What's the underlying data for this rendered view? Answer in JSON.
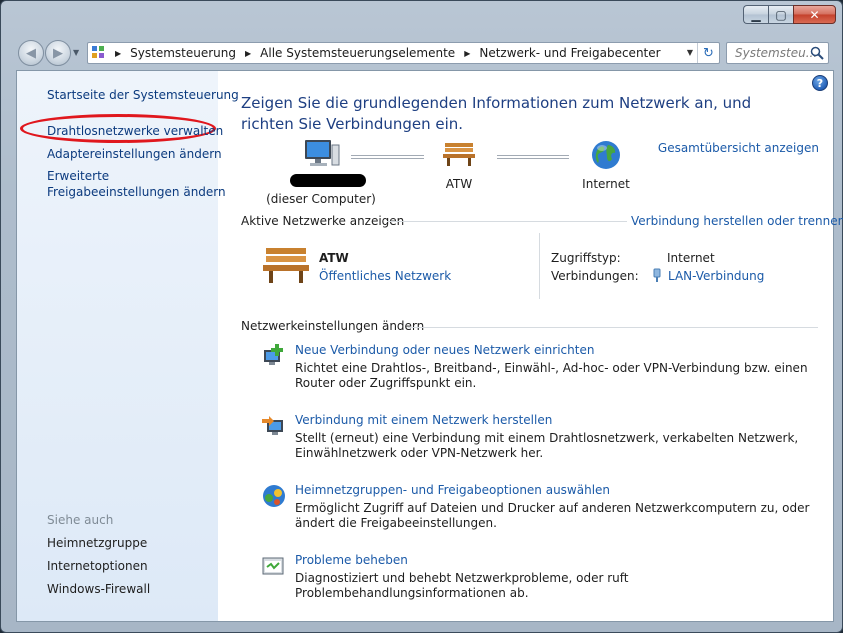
{
  "window": {
    "caption": {
      "minimize": "▁",
      "maximize": "▢",
      "close": "✕"
    }
  },
  "nav": {
    "back_glyph": "◀",
    "forward_glyph": "▶",
    "breadcrumbs": [
      "Systemsteuerung",
      "Alle Systemsteuerungselemente",
      "Netzwerk- und Freigabecenter"
    ],
    "refresh_glyph": "↻",
    "search_placeholder": "Systemsteu..."
  },
  "sidebar": {
    "links": [
      "Startseite der Systemsteuerung",
      "Drahtlosnetzwerke verwalten",
      "Adaptereinstellungen ändern"
    ],
    "link_multiline_1": "Erweiterte",
    "link_multiline_2": "Freigabeeinstellungen ändern",
    "see_also_heading": "Siehe auch",
    "see_also": [
      "Heimnetzgruppe",
      "Internetoptionen",
      "Windows-Firewall"
    ],
    "highlight_color": "#e0171d"
  },
  "main": {
    "help_label": "?",
    "title": "Zeigen Sie die grundlegenden Informationen zum Netzwerk an, und richten Sie Verbindungen ein.",
    "overview_link": "Gesamtübersicht anzeigen",
    "map": {
      "computer_label": "(dieser Computer)",
      "network_label": "ATW",
      "internet_label": "Internet"
    },
    "active_networks": {
      "heading": "Aktive Netzwerke anzeigen",
      "connect_link": "Verbindung herstellen oder trennen",
      "network_name": "ATW",
      "network_type": "Öffentliches Netzwerk",
      "access_label": "Zugriffstyp:",
      "access_value": "Internet",
      "connections_label": "Verbindungen:",
      "connections_value": "LAN-Verbindung"
    },
    "settings": {
      "heading": "Netzwerkeinstellungen ändern",
      "tasks": [
        {
          "link": "Neue Verbindung oder neues Netzwerk einrichten",
          "desc": "Richtet eine Drahtlos-, Breitband-, Einwähl-, Ad-hoc- oder VPN-Verbindung bzw. einen Router oder Zugriffspunkt ein.",
          "icon": "new-connection-icon"
        },
        {
          "link": "Verbindung mit einem Netzwerk herstellen",
          "desc": "Stellt (erneut) eine Verbindung mit einem Drahtlosnetzwerk, verkabelten Netzwerk, Einwählnetzwerk oder VPN-Netzwerk her.",
          "icon": "connect-network-icon"
        },
        {
          "link": "Heimnetzgruppen- und Freigabeoptionen auswählen",
          "desc": "Ermöglicht Zugriff auf Dateien und Drucker auf anderen Netzwerkcomputern zu, oder ändert die Freigabeeinstellungen.",
          "icon": "homegroup-icon"
        },
        {
          "link": "Probleme beheben",
          "desc": "Diagnostiziert und behebt Netzwerkprobleme, oder ruft Problembehandlungsinformationen ab.",
          "icon": "troubleshoot-icon"
        }
      ]
    }
  }
}
